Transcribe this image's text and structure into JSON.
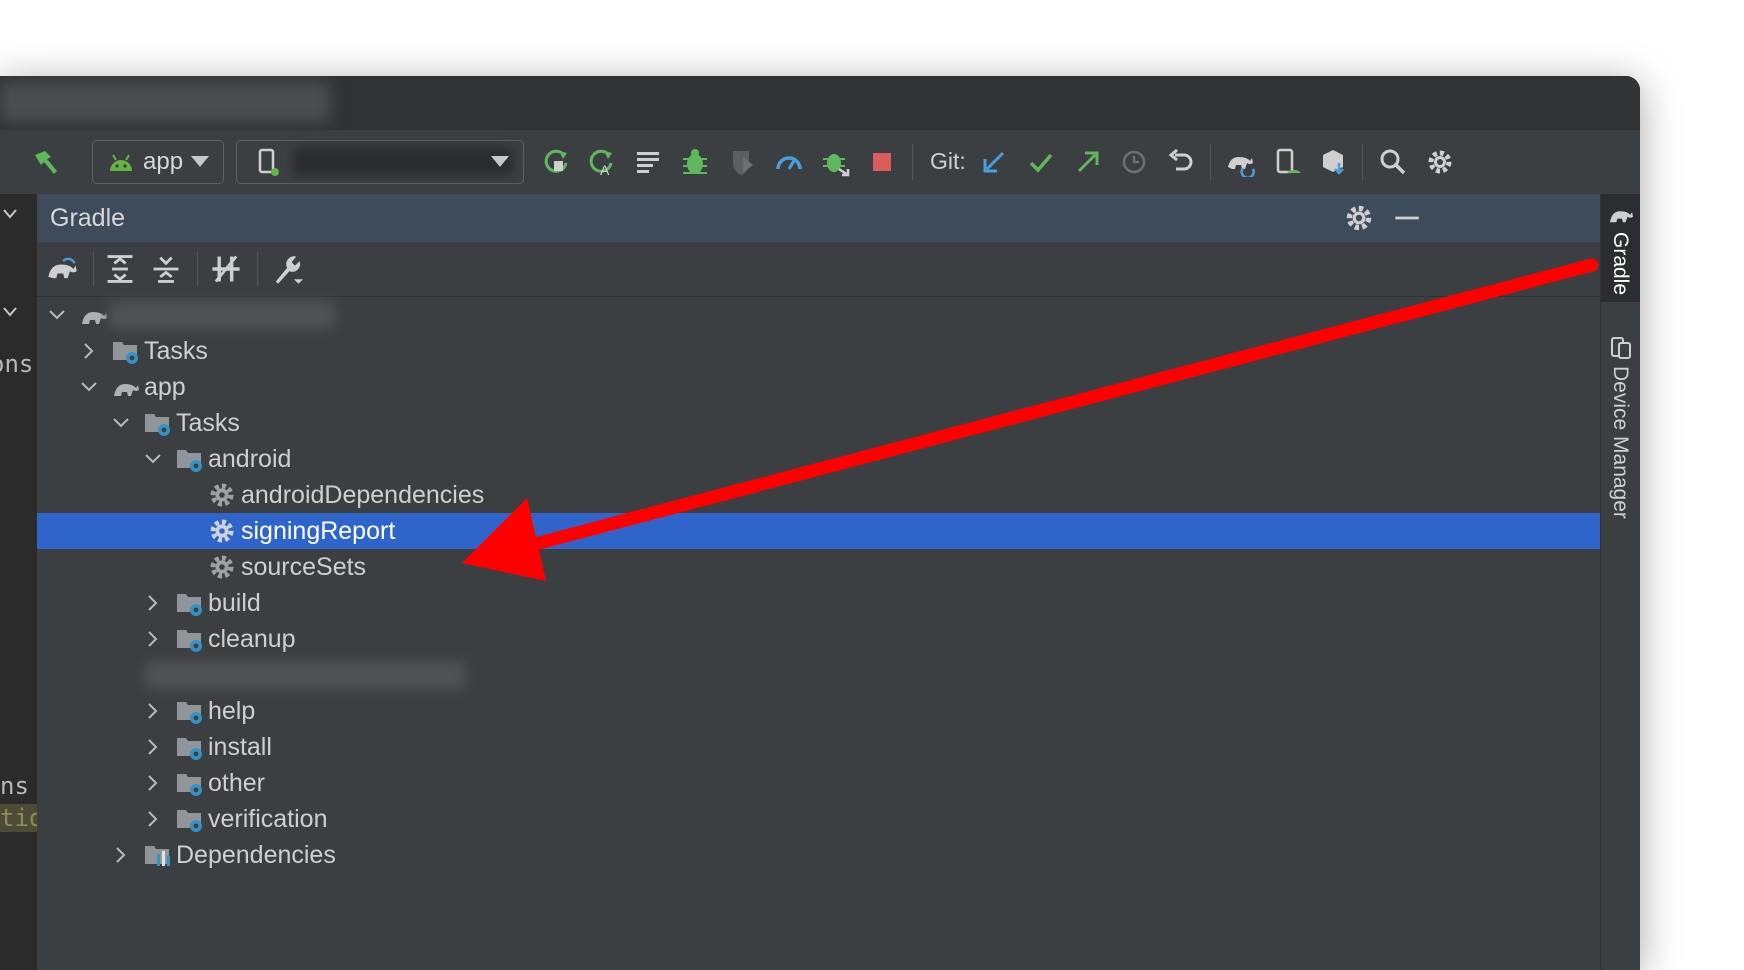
{
  "toolbar": {
    "run_config_label": "app",
    "git_label": "Git:"
  },
  "gradle_panel": {
    "title": "Gradle"
  },
  "tree": [
    {
      "label": "Tasks"
    },
    {
      "label": "app"
    },
    {
      "label": "Tasks"
    },
    {
      "label": "android"
    },
    {
      "label": "androidDependencies"
    },
    {
      "label": "signingReport",
      "selected": true
    },
    {
      "label": "sourceSets"
    },
    {
      "label": "build"
    },
    {
      "label": "cleanup"
    },
    {
      "label": "help"
    },
    {
      "label": "install"
    },
    {
      "label": "other"
    },
    {
      "label": "verification"
    },
    {
      "label": "Dependencies"
    }
  ],
  "right_tabs": {
    "gradle": "Gradle",
    "device_manager": "Device Manager"
  },
  "left_fragments": [
    "ons",
    "ns",
    "tio"
  ],
  "colors": {
    "selection": "#2f65ca",
    "annotation_arrow": "#ff0000",
    "panel_bg": "#3c3f41",
    "header_bg": "#3e4b5b"
  }
}
